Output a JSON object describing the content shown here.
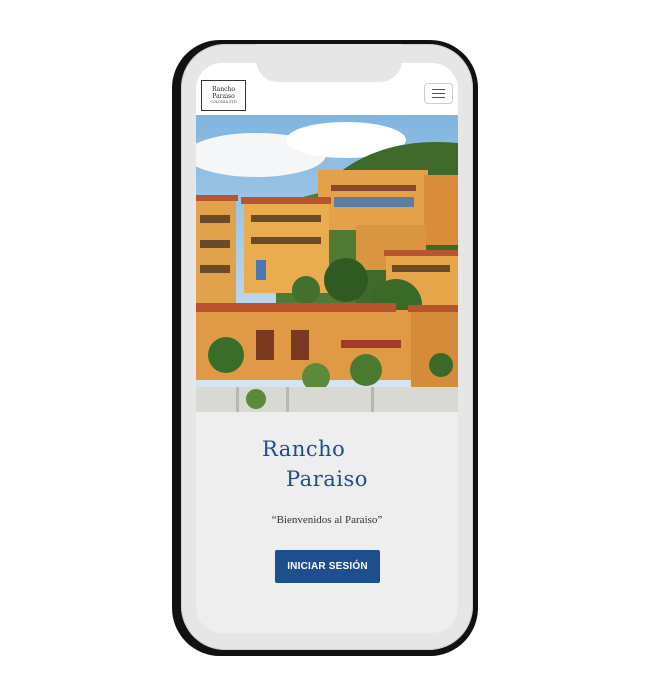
{
  "navbar": {
    "logo_line1": "Rancho",
    "logo_line2": "Paraiso",
    "logo_line3": "COLONIA STD",
    "menu_icon": "hamburger-icon"
  },
  "hero": {
    "image": "hillside-villas-photo"
  },
  "brand": {
    "word1": "Rancho",
    "word2": "Paraiso",
    "color": "#1d4f8e"
  },
  "tagline": "“Bienvenidos al Paraiso”",
  "login_button": "INICIAR SESIÓN"
}
